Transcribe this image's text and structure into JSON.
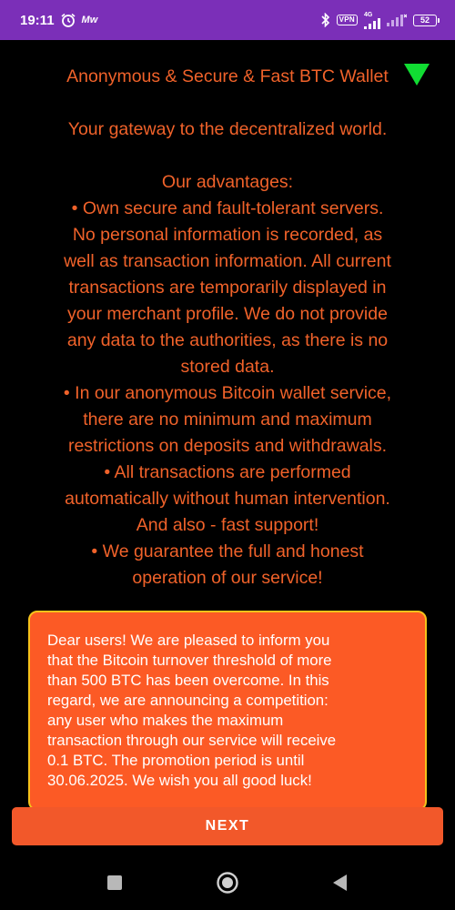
{
  "status_bar": {
    "time": "19:11",
    "carrier_badge": "Mw",
    "vpn_label": "VPN",
    "network_label": "4G",
    "battery_level": "52",
    "icons": [
      "alarm-icon",
      "bluetooth-icon",
      "vpn-icon",
      "signal-icon",
      "signal-icon-2",
      "battery-icon"
    ]
  },
  "content": {
    "title": "Anonymous & Secure & Fast BTC Wallet",
    "gateway": "Your gateway to the decentralized world.",
    "advantages_heading": "Our advantages:",
    "advantages_lines": [
      "• Own secure and fault-tolerant servers.",
      "No personal information is recorded, as",
      "well as transaction information. All current",
      "transactions are temporarily displayed in",
      "your merchant profile. We do not provide",
      "any data to the authorities, as there is no",
      "stored data.",
      "• In our anonymous Bitcoin wallet service,",
      "there are no minimum and maximum",
      "restrictions on deposits and withdrawals.",
      "• All transactions are performed",
      "automatically without human intervention.",
      "And also - fast support!",
      "• We guarantee the full and honest",
      "operation of our service!"
    ],
    "text_color": "#f0622a"
  },
  "notice": {
    "lines": [
      "Dear users! We are pleased to inform you",
      "that the Bitcoin turnover threshold of more",
      "than 500 BTC has been overcome. In this",
      "regard, we are announcing a competition:",
      "any user who makes the maximum",
      "transaction through our service will receive",
      "0.1 BTC. The promotion period is until",
      "30.06.2025. We wish you all good luck!"
    ],
    "background_color": "#fc5a25",
    "border_color": "#f5c21a"
  },
  "next_button": {
    "label": "NEXT",
    "color": "#f2582a"
  },
  "nav_bar": {
    "buttons": [
      "recents-square-icon",
      "home-circle-icon",
      "back-triangle-icon"
    ]
  },
  "accent_marker_color": "#11dd33"
}
